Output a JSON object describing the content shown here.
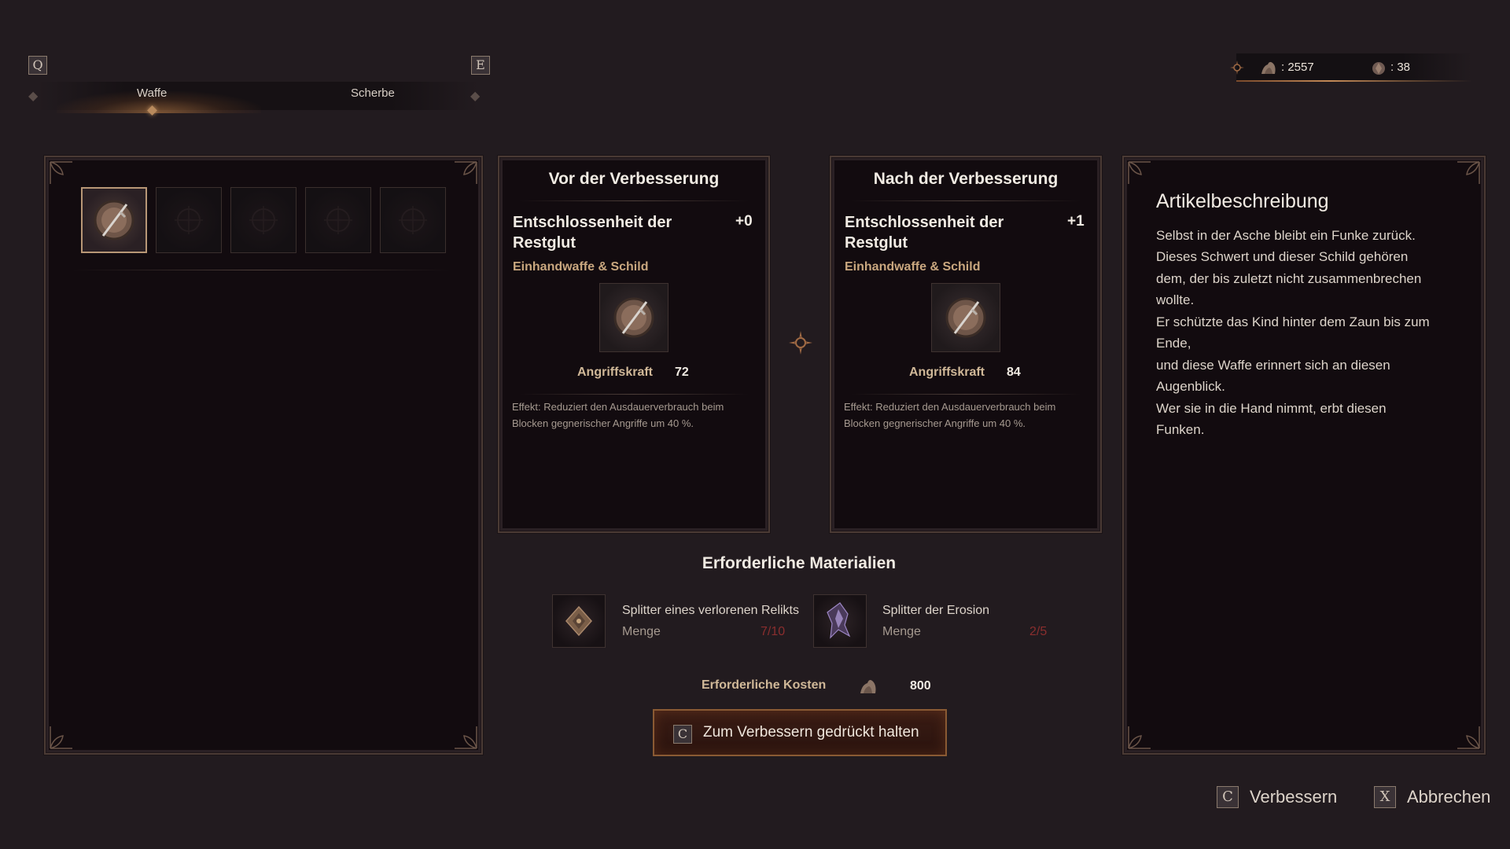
{
  "tabs": {
    "prev_key": "Q",
    "next_key": "E",
    "items": [
      {
        "label": "Waffe",
        "active": true
      },
      {
        "label": "Scherbe",
        "active": false
      }
    ]
  },
  "currency": {
    "souls": ": 2557",
    "shards": ": 38"
  },
  "inventory": {
    "slots": [
      {
        "icon": "sword-shield-icon",
        "selected": true
      },
      {
        "icon": "empty-slot-icon",
        "selected": false
      },
      {
        "icon": "empty-slot-icon",
        "selected": false
      },
      {
        "icon": "empty-slot-icon",
        "selected": false
      },
      {
        "icon": "empty-slot-icon",
        "selected": false
      }
    ]
  },
  "before": {
    "title": "Vor der Verbesserung",
    "item_name_line1": "Entschlossenheit der",
    "item_name_line2": "Restglut",
    "level": "+0",
    "type": "Einhandwaffe & Schild",
    "stat_label": "Angriffskraft",
    "stat_value": "72",
    "effect_line1": "Effekt: Reduziert den Ausdauerverbrauch beim",
    "effect_line2": "Blocken gegnerischer Angriffe um 40 %."
  },
  "after": {
    "title": "Nach der Verbesserung",
    "item_name_line1": "Entschlossenheit der",
    "item_name_line2": "Restglut",
    "level": "+1",
    "type": "Einhandwaffe & Schild",
    "stat_label": "Angriffskraft",
    "stat_value": "84",
    "effect_line1": "Effekt: Reduziert den Ausdauerverbrauch beim",
    "effect_line2": "Blocken gegnerischer Angriffe um 40 %."
  },
  "description": {
    "title": "Artikelbeschreibung",
    "lines": [
      "Selbst in der Asche bleibt ein Funke zurück.",
      "Dieses Schwert und dieser Schild gehören",
      "dem, der bis zuletzt nicht zusammenbrechen",
      "wollte.",
      "Er schützte das Kind hinter dem Zaun bis zum",
      "Ende,",
      "und diese Waffe erinnert sich an diesen",
      "Augenblick.",
      "Wer sie in die Hand nimmt, erbt diesen",
      "Funken."
    ]
  },
  "materials": {
    "title": "Erforderliche Materialien",
    "items": [
      {
        "name": "Splitter eines verlorenen Relikts",
        "qty_label": "Menge",
        "qty": "7/10",
        "icon": "relic-shard-icon"
      },
      {
        "name": "Splitter der Erosion",
        "qty_label": "Menge",
        "qty": "2/5",
        "icon": "erosion-shard-icon"
      }
    ],
    "cost_label": "Erforderliche Kosten",
    "cost_value": "800"
  },
  "hold_button": {
    "key": "C",
    "label": "Zum Verbessern gedrückt halten"
  },
  "footer": {
    "upgrade_key": "C",
    "upgrade_label": "Verbessern",
    "cancel_key": "X",
    "cancel_label": "Abbrechen"
  },
  "colors": {
    "background": "#221b1f",
    "panel": "#120b0f",
    "accent_gold": "#c9a77f",
    "insufficient_red": "#8a2e2e"
  }
}
